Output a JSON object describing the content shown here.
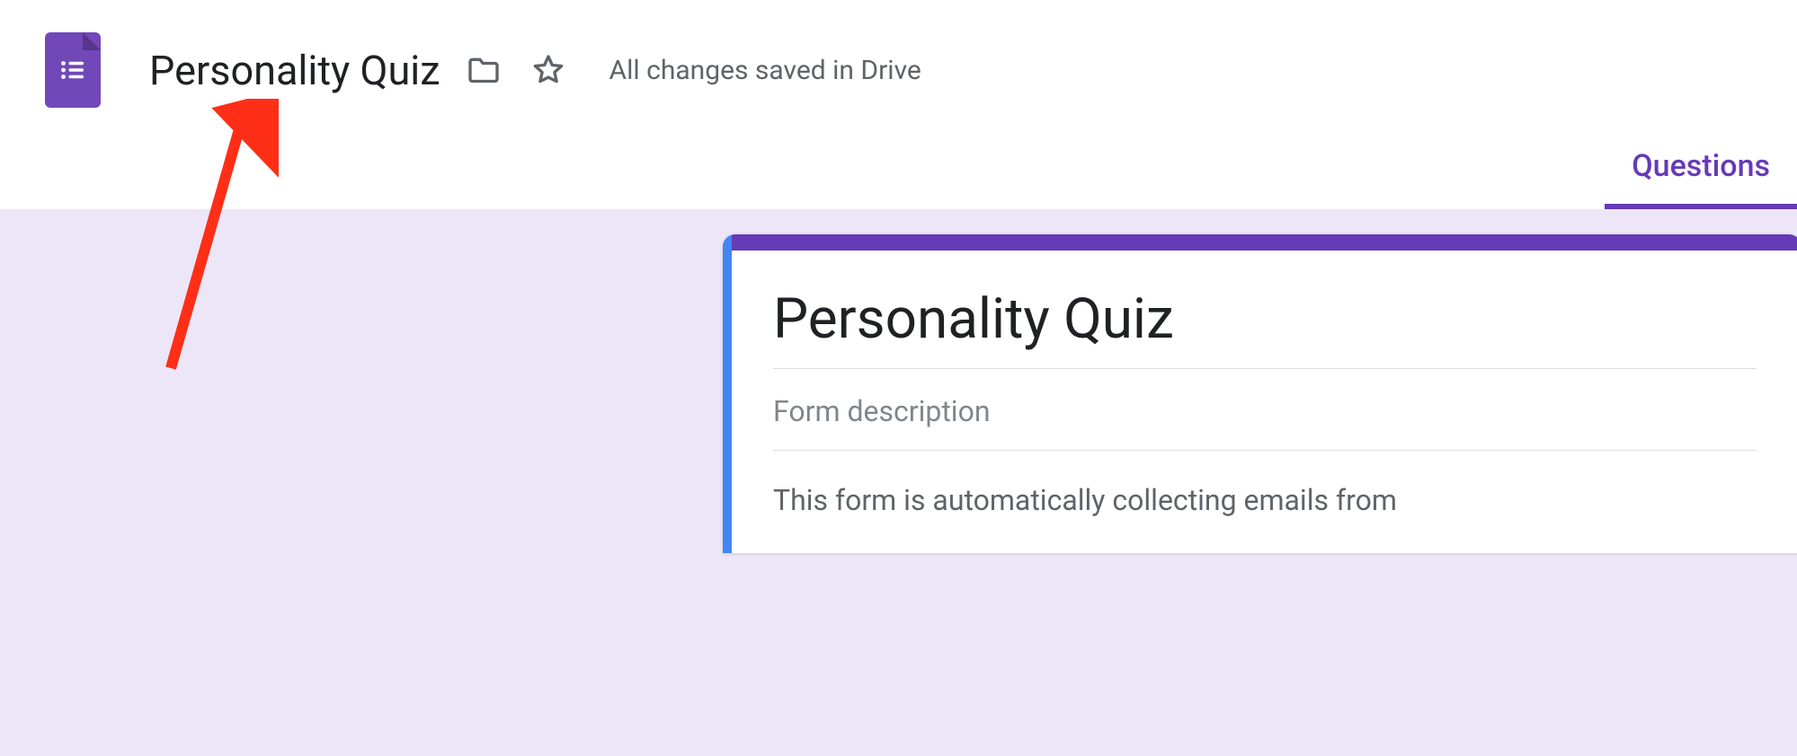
{
  "header": {
    "title": "Personality Quiz",
    "save_status": "All changes saved in Drive"
  },
  "tabs": {
    "questions": "Questions"
  },
  "form": {
    "title": "Personality Quiz",
    "description_placeholder": "Form description",
    "auto_collect_note": "This form is automatically collecting emails from"
  },
  "icons": {
    "app_logo": "google-forms-icon",
    "folder": "folder-icon",
    "star": "star-icon"
  },
  "colors": {
    "accent": "#673ab7",
    "highlight": "#4285f4",
    "logo": "#7248b9",
    "canvas_bg": "#ece6f6"
  }
}
